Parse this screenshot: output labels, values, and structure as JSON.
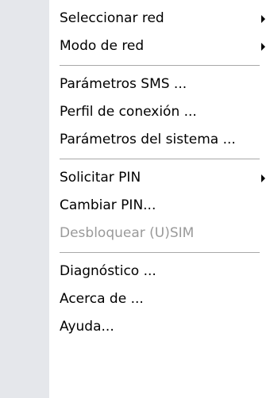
{
  "menu": {
    "group1": [
      {
        "label": "Seleccionar red",
        "submenu": true,
        "submenu_icon": "chevron-right-icon"
      },
      {
        "label": "Modo de red",
        "submenu": true,
        "submenu_icon": "chevron-right-icon"
      }
    ],
    "group2": [
      {
        "label": "Parámetros SMS ..."
      },
      {
        "label": "Perfil de conexión ..."
      },
      {
        "label": "Parámetros del sistema ..."
      }
    ],
    "group3": [
      {
        "label": "Solicitar PIN",
        "submenu": true,
        "submenu_icon": "chevron-right-icon"
      },
      {
        "label": "Cambiar PIN..."
      },
      {
        "label": "Desbloquear (U)SIM",
        "disabled": true
      }
    ],
    "group4": [
      {
        "label": "Diagnóstico ..."
      },
      {
        "label": "Acerca de ..."
      },
      {
        "label": "Ayuda..."
      }
    ]
  },
  "colors": {
    "gutter": "#e5e7eb",
    "text": "#000000",
    "disabled_text": "#9a9a9a",
    "separator": "#a8a8a8"
  }
}
